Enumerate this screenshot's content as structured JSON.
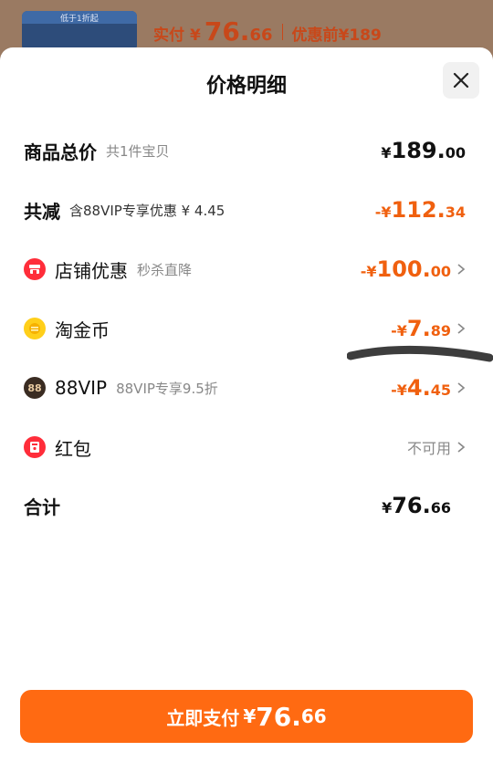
{
  "backdrop": {
    "thumb_text": "低于1折起",
    "pay_label": "实付",
    "currency": "¥",
    "pay_int": "76.",
    "pay_dec": "66",
    "orig_label": "优惠前",
    "orig_price": "¥189"
  },
  "sheet": {
    "title": "价格明细",
    "close_icon": "close-icon"
  },
  "rows": {
    "total": {
      "label": "商品总价",
      "sub": "共1件宝贝",
      "currency": "¥",
      "int": "189.",
      "dec": "00"
    },
    "discount": {
      "label": "共减",
      "sub": "含88VIP专享优惠 ¥ 4.45",
      "currency": "-¥",
      "int": "112.",
      "dec": "34"
    },
    "store": {
      "icon": "store-icon",
      "label": "店铺优惠",
      "sub": "秒杀直降",
      "currency": "-¥",
      "int": "100.",
      "dec": "00"
    },
    "coin": {
      "icon": "coin-icon",
      "label": "淘金币",
      "currency": "-¥",
      "int": "7.",
      "dec": "89"
    },
    "vip": {
      "icon": "88vip-icon",
      "icon_text": "88",
      "label": "88VIP",
      "sub": "88VIP专享9.5折",
      "currency": "-¥",
      "int": "4.",
      "dec": "45"
    },
    "redpacket": {
      "icon": "red-packet-icon",
      "label": "红包",
      "status": "不可用"
    },
    "sum": {
      "label": "合计",
      "currency": "¥",
      "int": "76.",
      "dec": "66"
    }
  },
  "pay_button": {
    "label": "立即支付",
    "currency": "¥",
    "int": "76.",
    "dec": "66"
  },
  "colors": {
    "accent": "#ff6a12",
    "discount": "#f0600f",
    "backdrop_price": "#c8481a"
  }
}
